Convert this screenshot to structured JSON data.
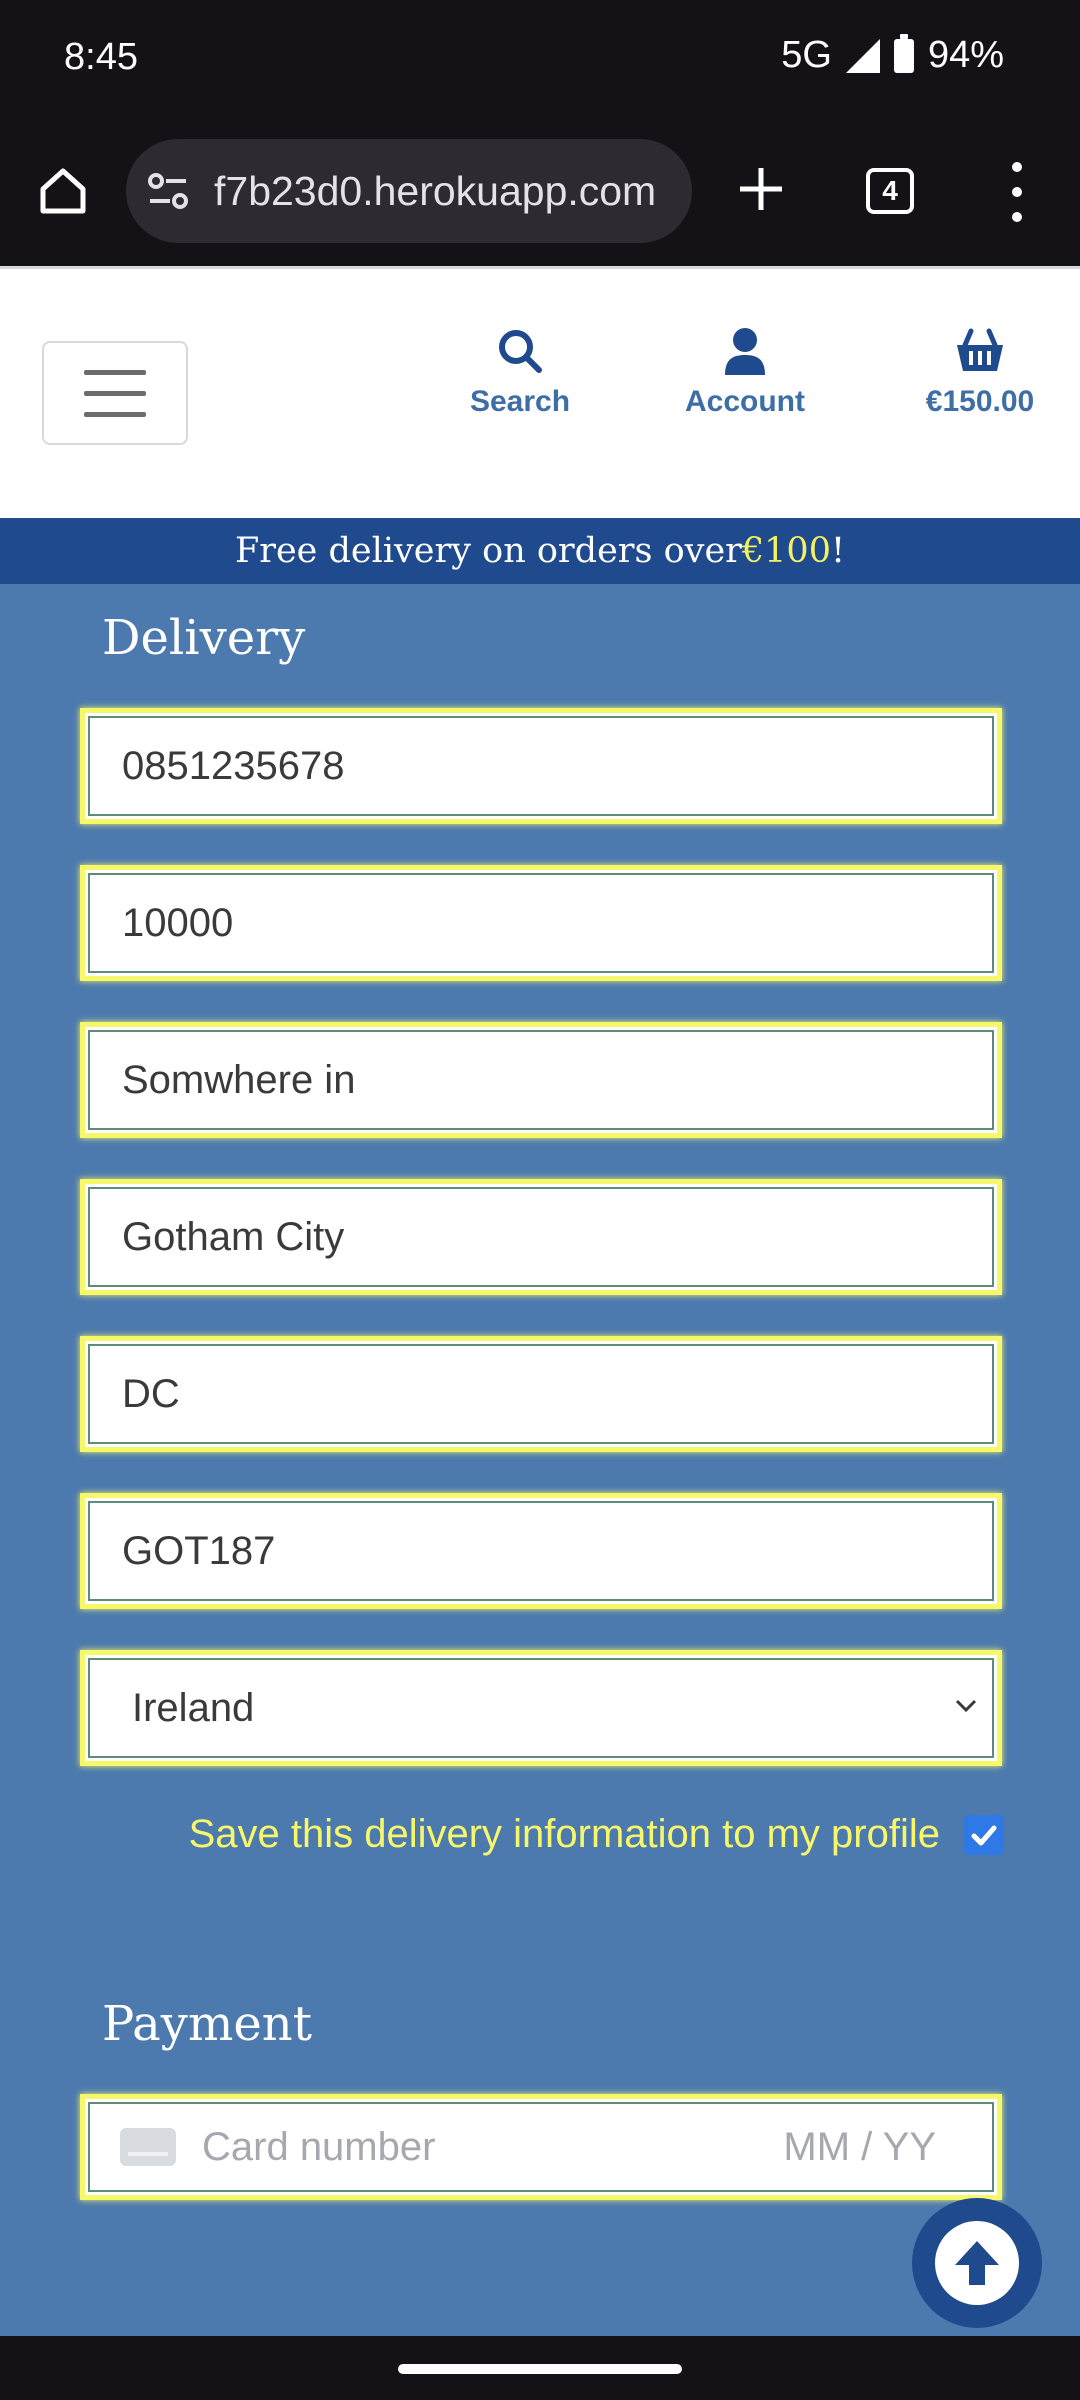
{
  "status": {
    "time": "8:45",
    "network": "5G",
    "battery": "94%"
  },
  "browser": {
    "url": "f7b23d0.herokuapp.com",
    "tab_count": "4"
  },
  "header": {
    "search_label": "Search",
    "account_label": "Account",
    "cart_total": "€150.00"
  },
  "banner": {
    "prefix": "Free delivery on orders over ",
    "amount": "€100",
    "suffix": "!"
  },
  "delivery": {
    "title": "Delivery",
    "phone": "0851235678",
    "postcode": "10000",
    "address": "Somwhere in",
    "town": "Gotham City",
    "county": "DC",
    "extra": "GOT187",
    "country": "Ireland",
    "save_label": "Save this delivery information to my profile",
    "save_checked": true
  },
  "payment": {
    "title": "Payment",
    "card_placeholder": "Card number",
    "expiry_placeholder": "MM / YY"
  },
  "colors": {
    "accent_yellow": "#f7f76a",
    "brand_blue": "#204a8e",
    "panel_blue": "#4d7aae",
    "link_blue": "#3d6ea6"
  }
}
